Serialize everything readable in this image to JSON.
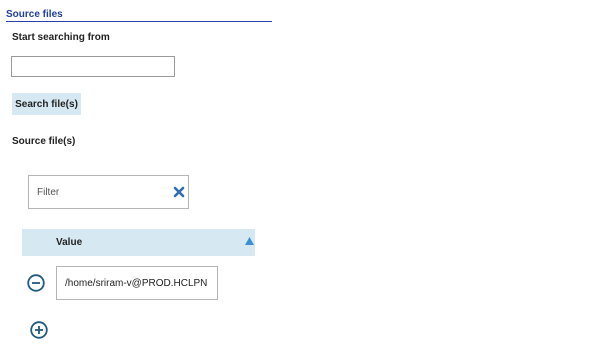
{
  "section": {
    "title": "Source files"
  },
  "start": {
    "label": "Start searching from",
    "value": ""
  },
  "search_button": {
    "label": "Search file(s)"
  },
  "source": {
    "label": "Source file(s)",
    "filter_placeholder": "Filter",
    "clear_icon": "x-icon",
    "table": {
      "column_header": "Value",
      "sort_icon": "triangle-up-icon",
      "rows": [
        {
          "value": "/home/sriram-v@PROD.HCLPN",
          "remove_icon": "minus-circle-icon"
        }
      ]
    },
    "add_icon": "plus-circle-icon"
  },
  "colors": {
    "title": "#1f3f9e",
    "accent_bg": "#d6e8f2",
    "icon": "#1f5a80",
    "clear_icon": "#2a6fb0"
  }
}
